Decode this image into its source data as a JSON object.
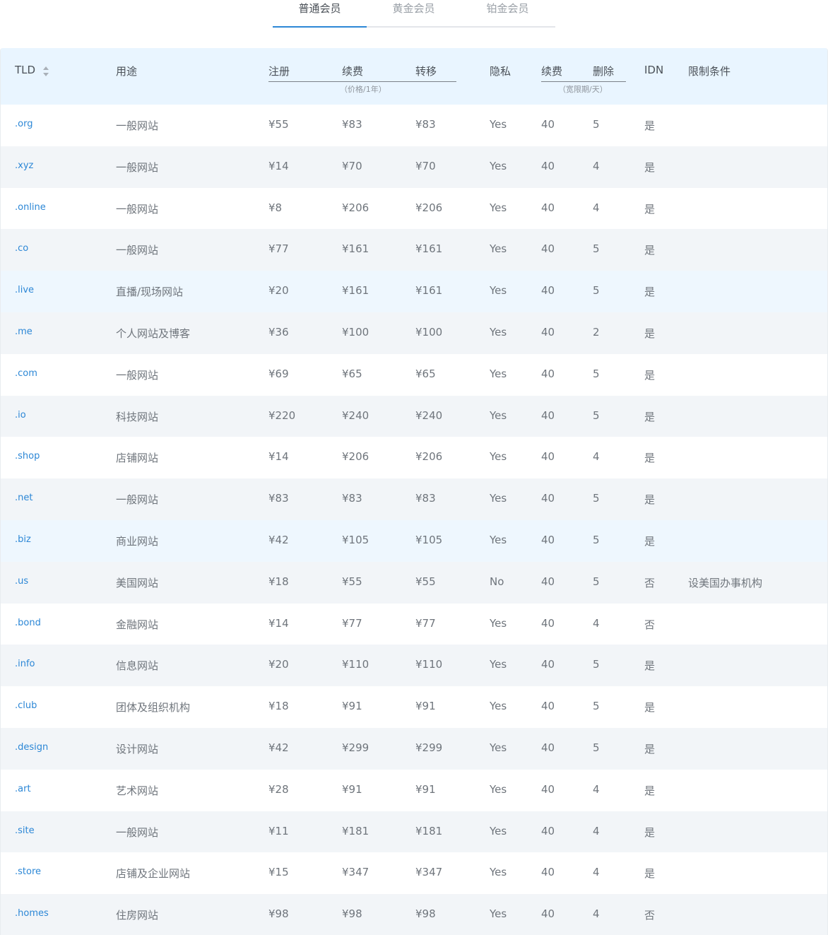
{
  "tabs": [
    "普通会员",
    "黄金会员",
    "铂金会员"
  ],
  "active_tab": 0,
  "header": {
    "tld": "TLD",
    "purpose": "用途",
    "register": "注册",
    "renew": "续费",
    "transfer": "转移",
    "price_note": "（价格/1年）",
    "privacy": "隐私",
    "grace_renew": "续费",
    "grace_delete": "删除",
    "grace_note": "（宽限期/天）",
    "idn": "IDN",
    "restriction": "限制条件"
  },
  "rows": [
    {
      "tld": ".org",
      "purpose": "一般网站",
      "register": "¥55",
      "renew": "¥83",
      "transfer": "¥83",
      "privacy": "Yes",
      "grace_renew": "40",
      "grace_delete": "5",
      "idn": "是",
      "restriction": ""
    },
    {
      "tld": ".xyz",
      "purpose": "一般网站",
      "register": "¥14",
      "renew": "¥70",
      "transfer": "¥70",
      "privacy": "Yes",
      "grace_renew": "40",
      "grace_delete": "4",
      "idn": "是",
      "restriction": ""
    },
    {
      "tld": ".online",
      "purpose": "一般网站",
      "register": "¥8",
      "renew": "¥206",
      "transfer": "¥206",
      "privacy": "Yes",
      "grace_renew": "40",
      "grace_delete": "4",
      "idn": "是",
      "restriction": ""
    },
    {
      "tld": ".co",
      "purpose": "一般网站",
      "register": "¥77",
      "renew": "¥161",
      "transfer": "¥161",
      "privacy": "Yes",
      "grace_renew": "40",
      "grace_delete": "5",
      "idn": "是",
      "restriction": ""
    },
    {
      "tld": ".live",
      "purpose": "直播/现场网站",
      "register": "¥20",
      "renew": "¥161",
      "transfer": "¥161",
      "privacy": "Yes",
      "grace_renew": "40",
      "grace_delete": "5",
      "idn": "是",
      "restriction": ""
    },
    {
      "tld": ".me",
      "purpose": "个人网站及博客",
      "register": "¥36",
      "renew": "¥100",
      "transfer": "¥100",
      "privacy": "Yes",
      "grace_renew": "40",
      "grace_delete": "2",
      "idn": "是",
      "restriction": ""
    },
    {
      "tld": ".com",
      "purpose": "一般网站",
      "register": "¥69",
      "renew": "¥65",
      "transfer": "¥65",
      "privacy": "Yes",
      "grace_renew": "40",
      "grace_delete": "5",
      "idn": "是",
      "restriction": ""
    },
    {
      "tld": ".io",
      "purpose": "科技网站",
      "register": "¥220",
      "renew": "¥240",
      "transfer": "¥240",
      "privacy": "Yes",
      "grace_renew": "40",
      "grace_delete": "5",
      "idn": "是",
      "restriction": ""
    },
    {
      "tld": ".shop",
      "purpose": "店铺网站",
      "register": "¥14",
      "renew": "¥206",
      "transfer": "¥206",
      "privacy": "Yes",
      "grace_renew": "40",
      "grace_delete": "4",
      "idn": "是",
      "restriction": ""
    },
    {
      "tld": ".net",
      "purpose": "一般网站",
      "register": "¥83",
      "renew": "¥83",
      "transfer": "¥83",
      "privacy": "Yes",
      "grace_renew": "40",
      "grace_delete": "5",
      "idn": "是",
      "restriction": ""
    },
    {
      "tld": ".biz",
      "purpose": "商业网站",
      "register": "¥42",
      "renew": "¥105",
      "transfer": "¥105",
      "privacy": "Yes",
      "grace_renew": "40",
      "grace_delete": "5",
      "idn": "是",
      "restriction": ""
    },
    {
      "tld": ".us",
      "purpose": "美国网站",
      "register": "¥18",
      "renew": "¥55",
      "transfer": "¥55",
      "privacy": "No",
      "grace_renew": "40",
      "grace_delete": "5",
      "idn": "否",
      "restriction": "设美国办事机构"
    },
    {
      "tld": ".bond",
      "purpose": "金融网站",
      "register": "¥14",
      "renew": "¥77",
      "transfer": "¥77",
      "privacy": "Yes",
      "grace_renew": "40",
      "grace_delete": "4",
      "idn": "否",
      "restriction": ""
    },
    {
      "tld": ".info",
      "purpose": "信息网站",
      "register": "¥20",
      "renew": "¥110",
      "transfer": "¥110",
      "privacy": "Yes",
      "grace_renew": "40",
      "grace_delete": "5",
      "idn": "是",
      "restriction": ""
    },
    {
      "tld": ".club",
      "purpose": "团体及组织机构",
      "register": "¥18",
      "renew": "¥91",
      "transfer": "¥91",
      "privacy": "Yes",
      "grace_renew": "40",
      "grace_delete": "5",
      "idn": "是",
      "restriction": ""
    },
    {
      "tld": ".design",
      "purpose": "设计网站",
      "register": "¥42",
      "renew": "¥299",
      "transfer": "¥299",
      "privacy": "Yes",
      "grace_renew": "40",
      "grace_delete": "5",
      "idn": "是",
      "restriction": ""
    },
    {
      "tld": ".art",
      "purpose": "艺术网站",
      "register": "¥28",
      "renew": "¥91",
      "transfer": "¥91",
      "privacy": "Yes",
      "grace_renew": "40",
      "grace_delete": "4",
      "idn": "是",
      "restriction": ""
    },
    {
      "tld": ".site",
      "purpose": "一般网站",
      "register": "¥11",
      "renew": "¥181",
      "transfer": "¥181",
      "privacy": "Yes",
      "grace_renew": "40",
      "grace_delete": "4",
      "idn": "是",
      "restriction": ""
    },
    {
      "tld": ".store",
      "purpose": "店铺及企业网站",
      "register": "¥15",
      "renew": "¥347",
      "transfer": "¥347",
      "privacy": "Yes",
      "grace_renew": "40",
      "grace_delete": "4",
      "idn": "是",
      "restriction": ""
    },
    {
      "tld": ".homes",
      "purpose": "住房网站",
      "register": "¥98",
      "renew": "¥98",
      "transfer": "¥98",
      "privacy": "Yes",
      "grace_renew": "40",
      "grace_delete": "4",
      "idn": "否",
      "restriction": ""
    }
  ]
}
